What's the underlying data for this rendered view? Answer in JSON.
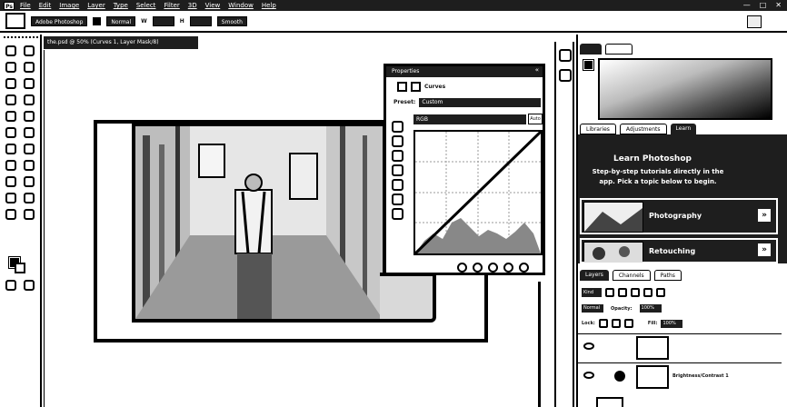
{
  "app": {
    "logo": "Ps"
  },
  "menubar": {
    "items": [
      "File",
      "Edit",
      "Image",
      "Layer",
      "Type",
      "Select",
      "Filter",
      "3D",
      "View",
      "Window",
      "Help"
    ],
    "controls": [
      "—",
      "□",
      "✕"
    ]
  },
  "options": {
    "preset": "Adobe Photoshop",
    "mode": "Normal",
    "width_label": "W",
    "height_label": "H",
    "smooth": "Smooth"
  },
  "document": {
    "tab_title": "the.psd @ 50% (Curves 1, Layer Mask/8)"
  },
  "properties": {
    "title": "Properties",
    "close": "«",
    "mode_label": "Curves",
    "preset_label": "Preset:",
    "preset_value": "Custom",
    "channel_value": "RGB",
    "auto_label": "Auto"
  },
  "right_panel": {
    "top_tabs": [
      "",
      "",
      ""
    ],
    "mid_tabs": [
      "Libraries",
      "Adjustments",
      "Learn"
    ],
    "learn": {
      "title": "Learn Photoshop",
      "subtitle": "Step-by-step tutorials directly in the app. Pick a topic below to begin.",
      "cards": [
        {
          "label": "Photography",
          "arrow": "»"
        },
        {
          "label": "Retouching",
          "arrow": "»"
        }
      ]
    }
  },
  "layers": {
    "tabs": [
      "Layers",
      "Channels",
      "Paths"
    ],
    "kind": "Kind",
    "blend": "Normal",
    "opacity_label": "Opacity:",
    "opacity_value": "100%",
    "lock_label": "Lock:",
    "fill_label": "Fill:",
    "fill_value": "100%",
    "rows": [
      {
        "name": ""
      },
      {
        "name": "Brightness/Contrast 1"
      }
    ]
  }
}
